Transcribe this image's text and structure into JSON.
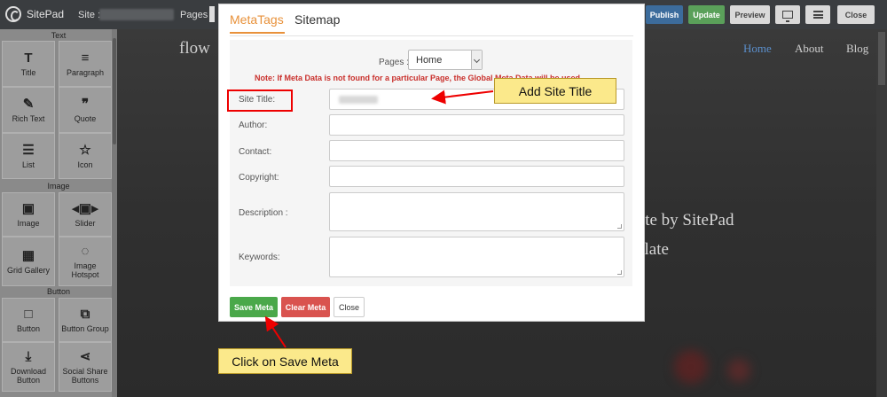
{
  "editor": {
    "brand": "SitePad",
    "site_label": "Site :",
    "pages_label": "Pages :",
    "buttons": {
      "publish": "Publish",
      "update": "Update",
      "preview": "Preview",
      "close": "Close"
    },
    "icons": {
      "device": "monitor-icon",
      "menu": "hamburger-icon"
    }
  },
  "sidebar": {
    "sections": {
      "text": "Text",
      "image": "Image",
      "button": "Button"
    },
    "items": [
      {
        "label": "Title",
        "icon": "T"
      },
      {
        "label": "Paragraph",
        "icon": "≡"
      },
      {
        "label": "Rich Text",
        "icon": "✎"
      },
      {
        "label": "Quote",
        "icon": "❞"
      },
      {
        "label": "List",
        "icon": "☰"
      },
      {
        "label": "Icon",
        "icon": "☆"
      },
      {
        "label": "Image",
        "icon": "▣"
      },
      {
        "label": "Slider",
        "icon": "◂▣▸"
      },
      {
        "label": "Grid Gallery",
        "icon": "▦"
      },
      {
        "label": "Image Hotspot",
        "icon": "◌"
      },
      {
        "label": "Button",
        "icon": "□"
      },
      {
        "label": "Button Group",
        "icon": "⧉"
      },
      {
        "label": "Download Button",
        "icon": "⤓"
      },
      {
        "label": "Social Share Buttons",
        "icon": "⋖"
      }
    ]
  },
  "site": {
    "logo_text": "flow",
    "nav": {
      "home": "Home",
      "about": "About",
      "blog": "Blog"
    },
    "hero_line1": "plate by SitePad",
    "hero_line2": "plate"
  },
  "modal": {
    "tabs": {
      "metatags": "MetaTags",
      "sitemap": "Sitemap"
    },
    "pages_label": "Pages :",
    "pages_selected": "Home",
    "note": "Note: If Meta Data is not found for a particular Page, the Global Meta Data will be used.",
    "fields": {
      "site_title": "Site Title:",
      "author": "Author:",
      "contact": "Contact:",
      "copyright": "Copyright:",
      "description": "Description :",
      "keywords": "Keywords:"
    },
    "buttons": {
      "save": "Save Meta",
      "clear": "Clear Meta",
      "close": "Close"
    }
  },
  "callouts": {
    "site_title": "Add Site Title",
    "save_meta": "Click on Save Meta"
  },
  "colors": {
    "accent": "#e8913a",
    "save": "#4aa84a",
    "clear": "#d9534f",
    "note": "#c9302c",
    "highlight": "#ee0000",
    "callout": "#fbe98b"
  }
}
